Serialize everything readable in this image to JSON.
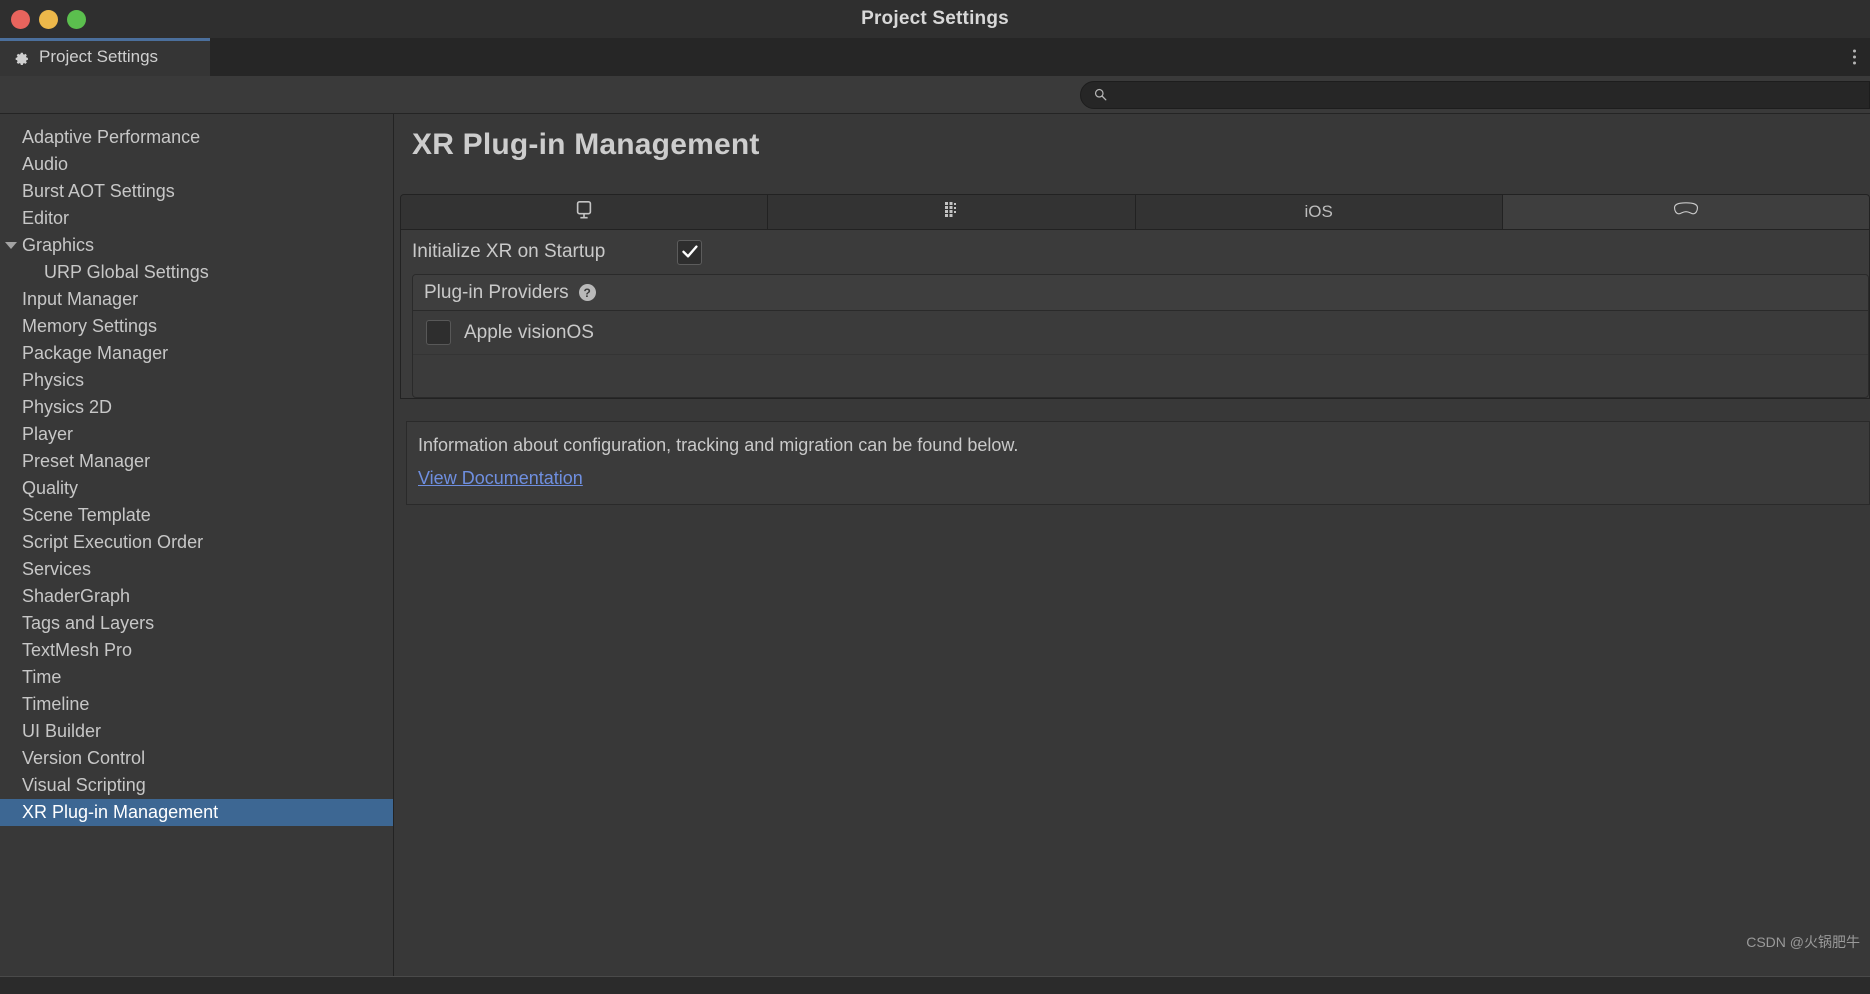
{
  "window": {
    "title": "Project Settings",
    "traffic_lights": [
      "close-button",
      "minimize-button",
      "zoom-button"
    ],
    "colors": {
      "close": "#e8645d",
      "minimize": "#edb84a",
      "zoom": "#5bbf4e",
      "accent_tab": "#4b6f9c",
      "selection": "#3d6793",
      "link": "#6f8fe0"
    }
  },
  "editor_tab": {
    "label": "Project Settings",
    "icon": "gear-icon",
    "menu_icon": "kebab-menu-icon"
  },
  "search": {
    "value": "",
    "placeholder": "",
    "icon": "search-icon"
  },
  "sidebar": {
    "items": [
      {
        "label": "Adaptive Performance",
        "level": 0,
        "selected": false,
        "expandable": false
      },
      {
        "label": "Audio",
        "level": 0,
        "selected": false,
        "expandable": false
      },
      {
        "label": "Burst AOT Settings",
        "level": 0,
        "selected": false,
        "expandable": false
      },
      {
        "label": "Editor",
        "level": 0,
        "selected": false,
        "expandable": false
      },
      {
        "label": "Graphics",
        "level": 0,
        "selected": false,
        "expandable": true
      },
      {
        "label": "URP Global Settings",
        "level": 1,
        "selected": false,
        "expandable": false
      },
      {
        "label": "Input Manager",
        "level": 0,
        "selected": false,
        "expandable": false
      },
      {
        "label": "Memory Settings",
        "level": 0,
        "selected": false,
        "expandable": false
      },
      {
        "label": "Package Manager",
        "level": 0,
        "selected": false,
        "expandable": false
      },
      {
        "label": "Physics",
        "level": 0,
        "selected": false,
        "expandable": false
      },
      {
        "label": "Physics 2D",
        "level": 0,
        "selected": false,
        "expandable": false
      },
      {
        "label": "Player",
        "level": 0,
        "selected": false,
        "expandable": false
      },
      {
        "label": "Preset Manager",
        "level": 0,
        "selected": false,
        "expandable": false
      },
      {
        "label": "Quality",
        "level": 0,
        "selected": false,
        "expandable": false
      },
      {
        "label": "Scene Template",
        "level": 0,
        "selected": false,
        "expandable": false
      },
      {
        "label": "Script Execution Order",
        "level": 0,
        "selected": false,
        "expandable": false
      },
      {
        "label": "Services",
        "level": 0,
        "selected": false,
        "expandable": false
      },
      {
        "label": "ShaderGraph",
        "level": 0,
        "selected": false,
        "expandable": false
      },
      {
        "label": "Tags and Layers",
        "level": 0,
        "selected": false,
        "expandable": false
      },
      {
        "label": "TextMesh Pro",
        "level": 0,
        "selected": false,
        "expandable": false
      },
      {
        "label": "Time",
        "level": 0,
        "selected": false,
        "expandable": false
      },
      {
        "label": "Timeline",
        "level": 0,
        "selected": false,
        "expandable": false
      },
      {
        "label": "UI Builder",
        "level": 0,
        "selected": false,
        "expandable": false
      },
      {
        "label": "Version Control",
        "level": 0,
        "selected": false,
        "expandable": false
      },
      {
        "label": "Visual Scripting",
        "level": 0,
        "selected": false,
        "expandable": false
      },
      {
        "label": "XR Plug-in Management",
        "level": 0,
        "selected": true,
        "expandable": false
      }
    ]
  },
  "main": {
    "title": "XR Plug-in Management",
    "platform_tabs": [
      {
        "label": "",
        "icon": "desktop-monitor-icon",
        "active": false
      },
      {
        "label": "",
        "icon": "android-icon",
        "active": false
      },
      {
        "label": "iOS",
        "icon": "",
        "active": false
      },
      {
        "label": "",
        "icon": "visionos-headset-icon",
        "active": true
      }
    ],
    "initialize_xr": {
      "label": "Initialize XR on Startup",
      "checked": true
    },
    "plugin_providers": {
      "title": "Plug-in Providers",
      "help_icon": "help-question-icon",
      "help_glyph": "?",
      "providers": [
        {
          "label": "Apple visionOS",
          "checked": false
        }
      ]
    },
    "info": {
      "text": "Information about configuration, tracking and migration can be found below.",
      "link_label": "View Documentation"
    }
  },
  "watermark": "CSDN @火锅肥牛"
}
